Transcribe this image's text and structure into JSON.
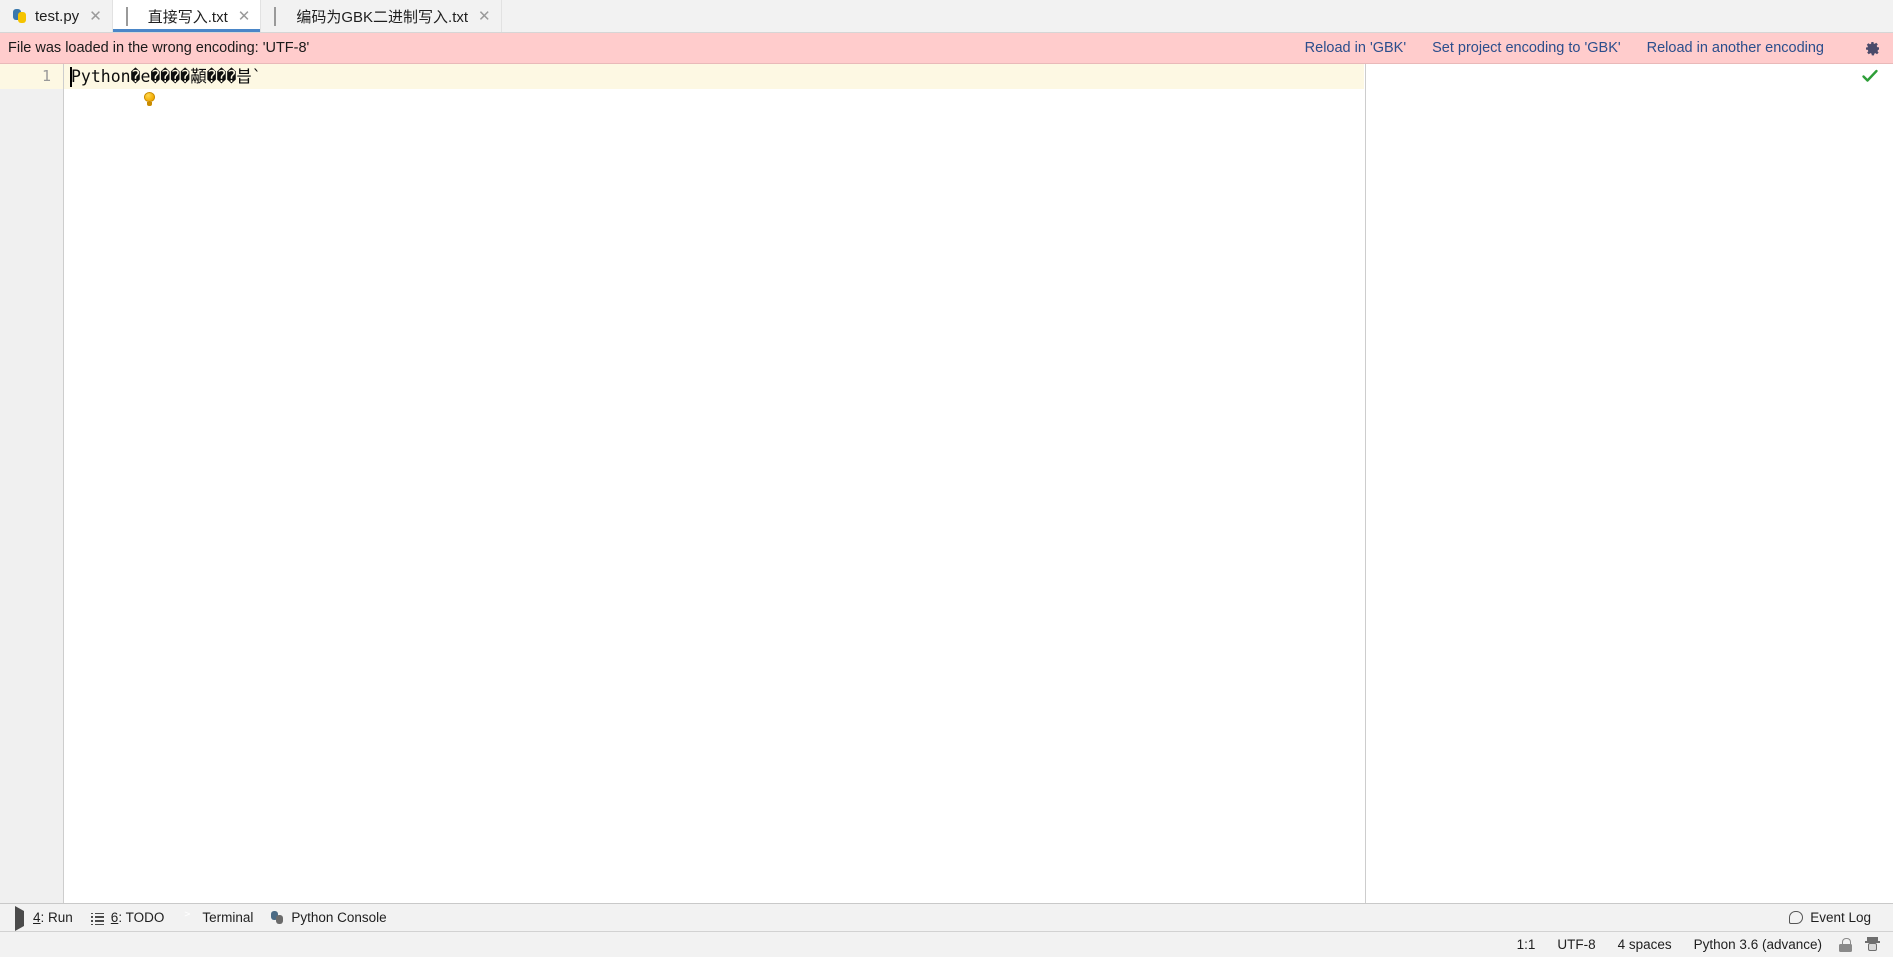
{
  "tabs": [
    {
      "label": "test.py",
      "icon": "python-file-icon",
      "active": false,
      "closable": true
    },
    {
      "label": "直接写入.txt",
      "icon": "text-file-icon",
      "active": true,
      "closable": true
    },
    {
      "label": "编码为GBK二进制写入.txt",
      "icon": "text-file-icon",
      "active": false,
      "closable": true
    }
  ],
  "banner": {
    "message": "File was loaded in the wrong encoding: 'UTF-8'",
    "background_color": "#ffcccc",
    "link_color": "#2b4e8c",
    "actions": [
      {
        "label": "Reload in 'GBK'"
      },
      {
        "label": "Set project encoding to 'GBK'"
      },
      {
        "label": "Reload in another encoding"
      }
    ],
    "settings_icon": "gear-icon"
  },
  "editor": {
    "line_number": "1",
    "content": "Python�e����顢���븝`",
    "intention_icon": "lightbulb-icon",
    "inspection_status_icon": "green-check-icon",
    "inspection_status_color": "#2e9e38",
    "current_line_highlight": "#fdf8e3"
  },
  "bottom_toolbar": {
    "buttons": [
      {
        "mnemonic": "4",
        "label": ": Run",
        "icon": "run-icon"
      },
      {
        "mnemonic": "6",
        "label": ": TODO",
        "icon": "todo-icon"
      },
      {
        "mnemonic": "",
        "label": "Terminal",
        "icon": "terminal-icon"
      },
      {
        "mnemonic": "",
        "label": "Python Console",
        "icon": "python-console-icon"
      }
    ],
    "event_log": {
      "label": "Event Log",
      "icon": "balloon-icon"
    }
  },
  "status_bar": {
    "caret_position": "1:1",
    "encoding": "UTF-8",
    "indent": "4 spaces",
    "interpreter": "Python 3.6 (advance)",
    "lock_icon": "unlocked-icon",
    "inspection_icon": "hector-inspector-icon"
  }
}
